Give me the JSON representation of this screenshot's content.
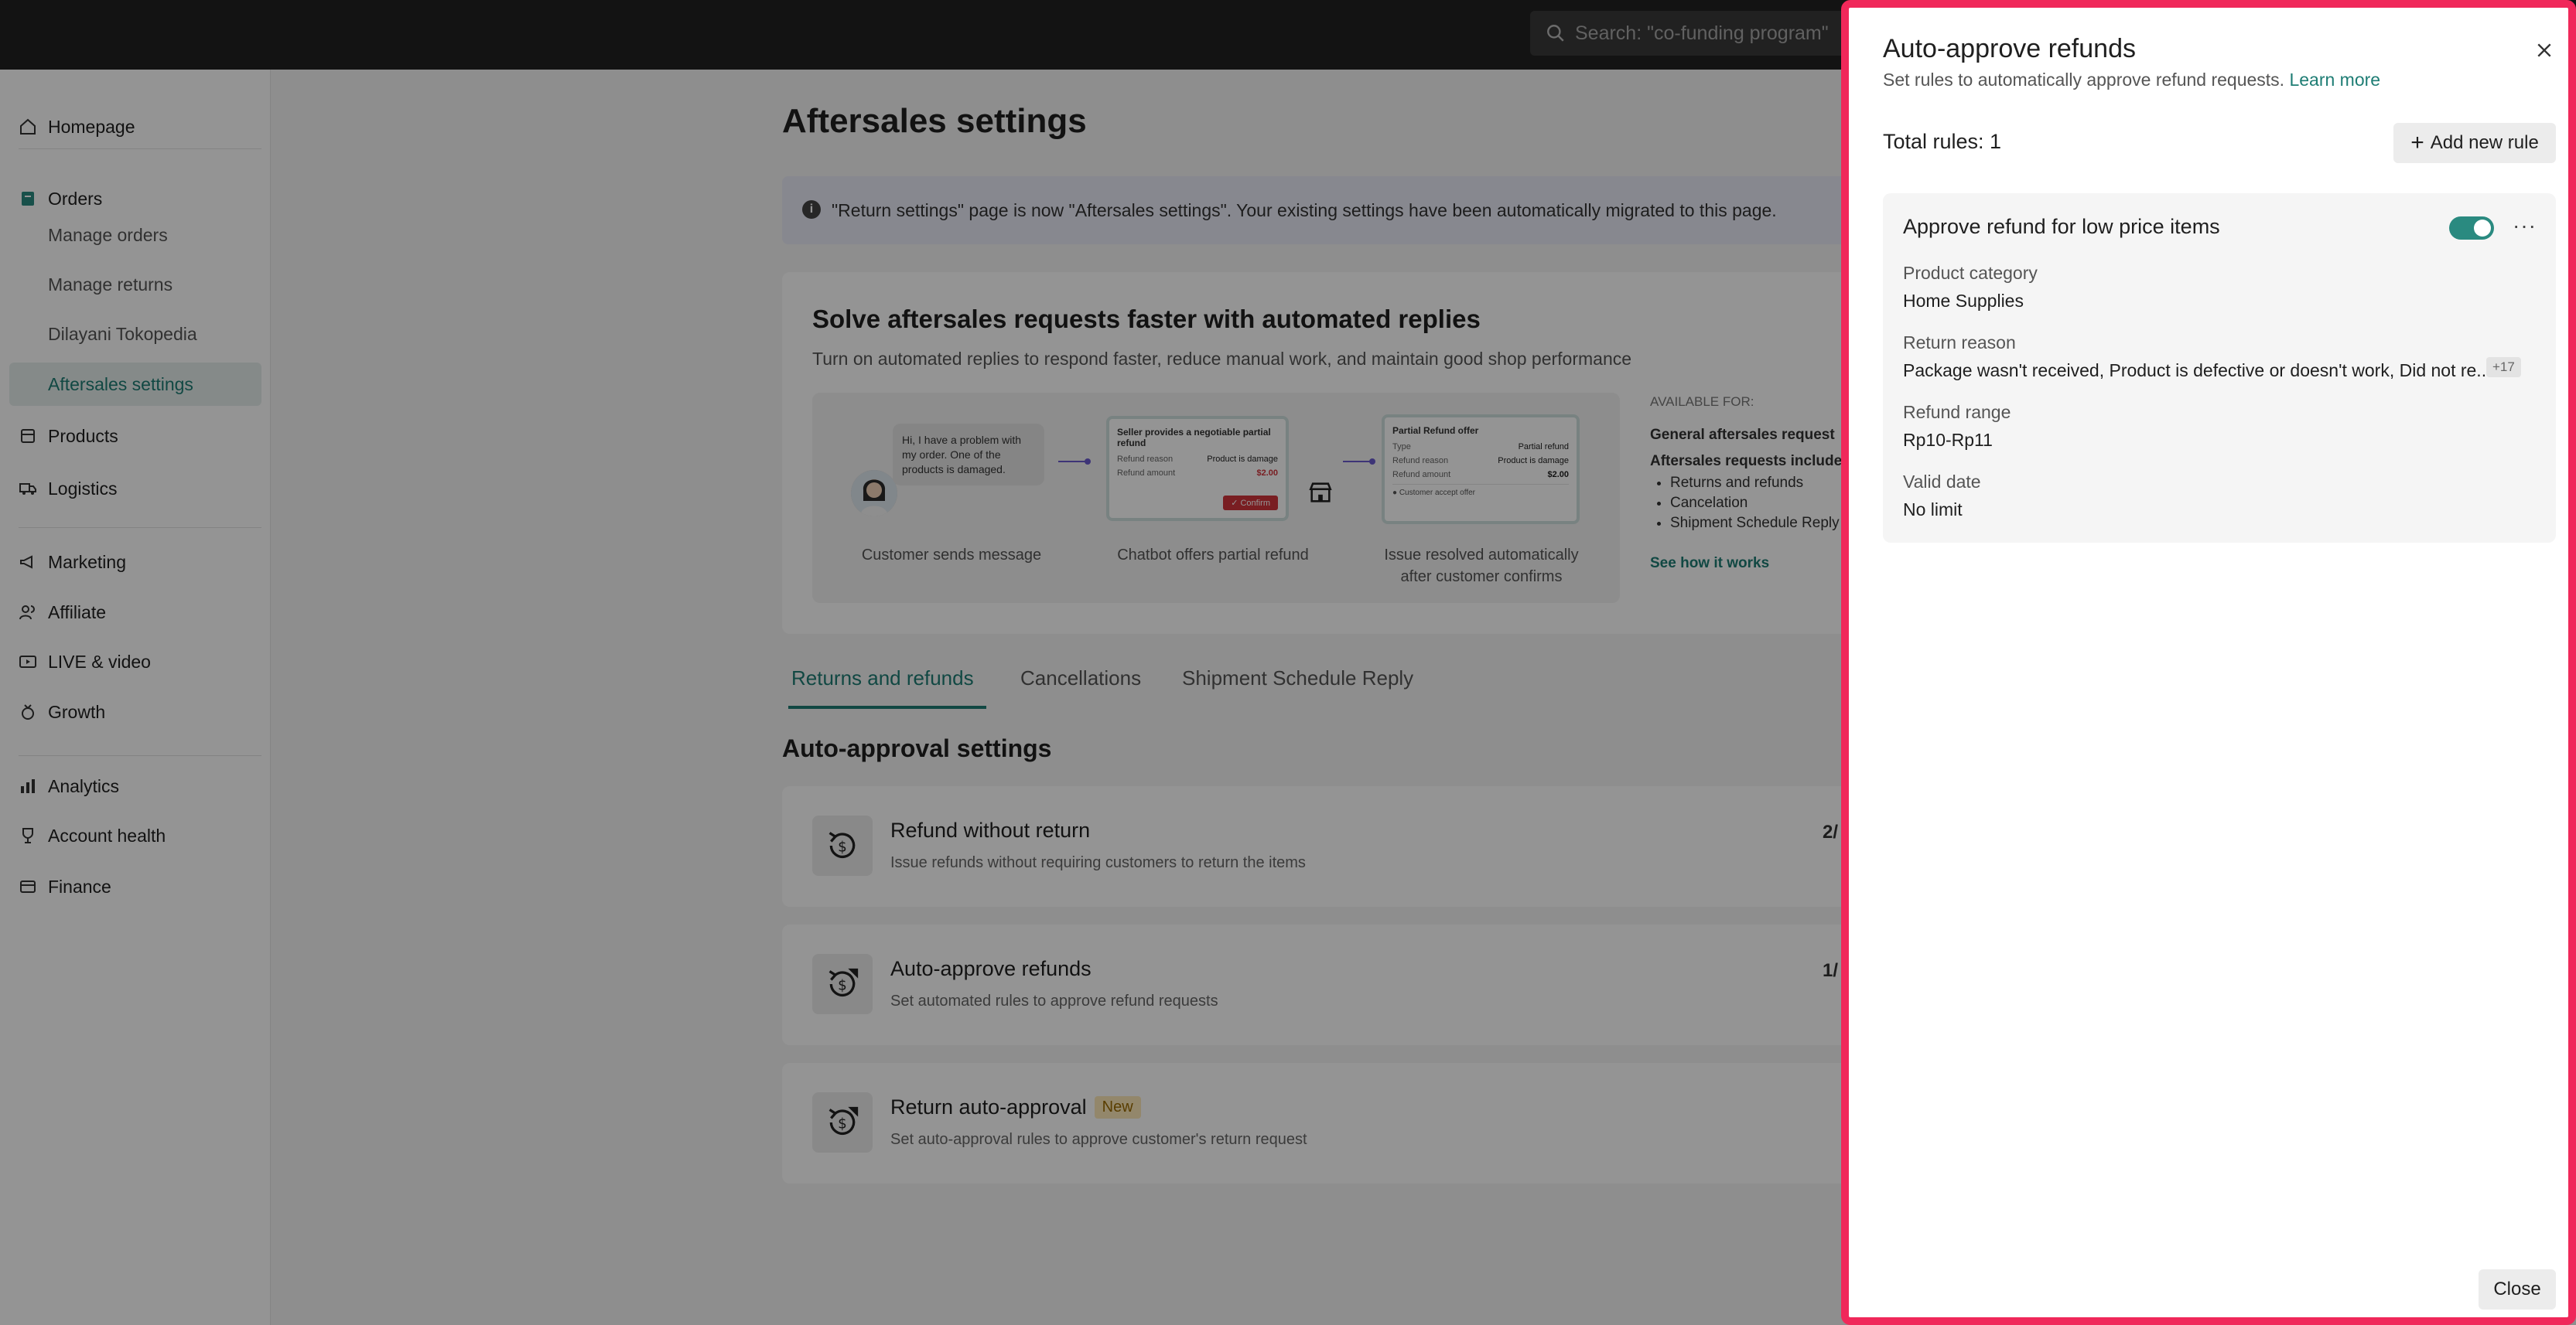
{
  "topbar": {
    "search_placeholder": "Search: \"co-funding program\""
  },
  "sidebar": {
    "homepage": "Homepage",
    "orders": "Orders",
    "manage_orders": "Manage orders",
    "manage_returns": "Manage returns",
    "dilayani": "Dilayani Tokopedia",
    "aftersales": "Aftersales settings",
    "products": "Products",
    "logistics": "Logistics",
    "marketing": "Marketing",
    "affiliate": "Affiliate",
    "live_video": "LIVE & video",
    "growth": "Growth",
    "analytics": "Analytics",
    "account_health": "Account health",
    "finance": "Finance"
  },
  "main": {
    "title": "Aftersales settings",
    "banner": "\"Return settings\" page is now \"Aftersales settings\". Your existing settings have been automatically migrated to this page.",
    "promo": {
      "title": "Solve aftersales requests faster with automated replies",
      "subtitle": "Turn on automated replies to respond faster, reduce manual work, and maintain good shop performance",
      "bubble": "Hi, I have a problem with my order. One of the products is damaged.",
      "card1": {
        "title": "Seller provides a negotiable partial refund",
        "reason_label": "Refund reason",
        "reason_value": "Product is damage",
        "amount_label": "Refund amount",
        "amount_value": "$2.00",
        "confirm": "✓ Confirm"
      },
      "card2": {
        "title": "Partial Refund offer",
        "type_label": "Type",
        "type_value": "Partial refund",
        "reason_label": "Refund reason",
        "reason_value": "Product is damage",
        "amount_label": "Refund amount",
        "amount_value": "$2.00",
        "footer": "● Customer accept offer"
      },
      "step1": "Customer sends message",
      "step2": "Chatbot offers partial refund",
      "step3a": "Issue resolved automatically",
      "step3b": "after customer confirms",
      "available_for": "AVAILABLE FOR:",
      "general": "General aftersales request",
      "includes": "Aftersales requests include",
      "list": [
        "Returns and refunds",
        "Cancelation",
        "Shipment Schedule Reply"
      ],
      "see_how": "See how it works"
    },
    "tabs": [
      "Returns and refunds",
      "Cancellations",
      "Shipment Schedule Reply"
    ],
    "section_title": "Auto-approval settings",
    "settings": [
      {
        "title": "Refund without return",
        "desc": "Issue refunds without requiring customers to return the items",
        "count": "2/"
      },
      {
        "title": "Auto-approve refunds",
        "desc": "Set automated rules to approve refund requests",
        "count": "1/"
      },
      {
        "title": "Return auto-approval",
        "badge": "New",
        "desc": "Set auto-approval rules to approve customer's return request"
      }
    ]
  },
  "drawer": {
    "title": "Auto-approve refunds",
    "subtitle": "Set rules to automatically approve refund requests.",
    "learn_more": "Learn more",
    "total": "Total rules: 1",
    "add_rule": "Add new rule",
    "rule": {
      "title": "Approve refund for low price items",
      "enabled": true,
      "category_label": "Product category",
      "category_value": "Home Supplies",
      "reason_label": "Return reason",
      "reason_value": "Package wasn't received, Product is defective or doesn't work, Did not re...",
      "reason_more": "+17",
      "range_label": "Refund range",
      "range_value": "Rp10-Rp11",
      "date_label": "Valid date",
      "date_value": "No limit"
    },
    "close": "Close"
  }
}
